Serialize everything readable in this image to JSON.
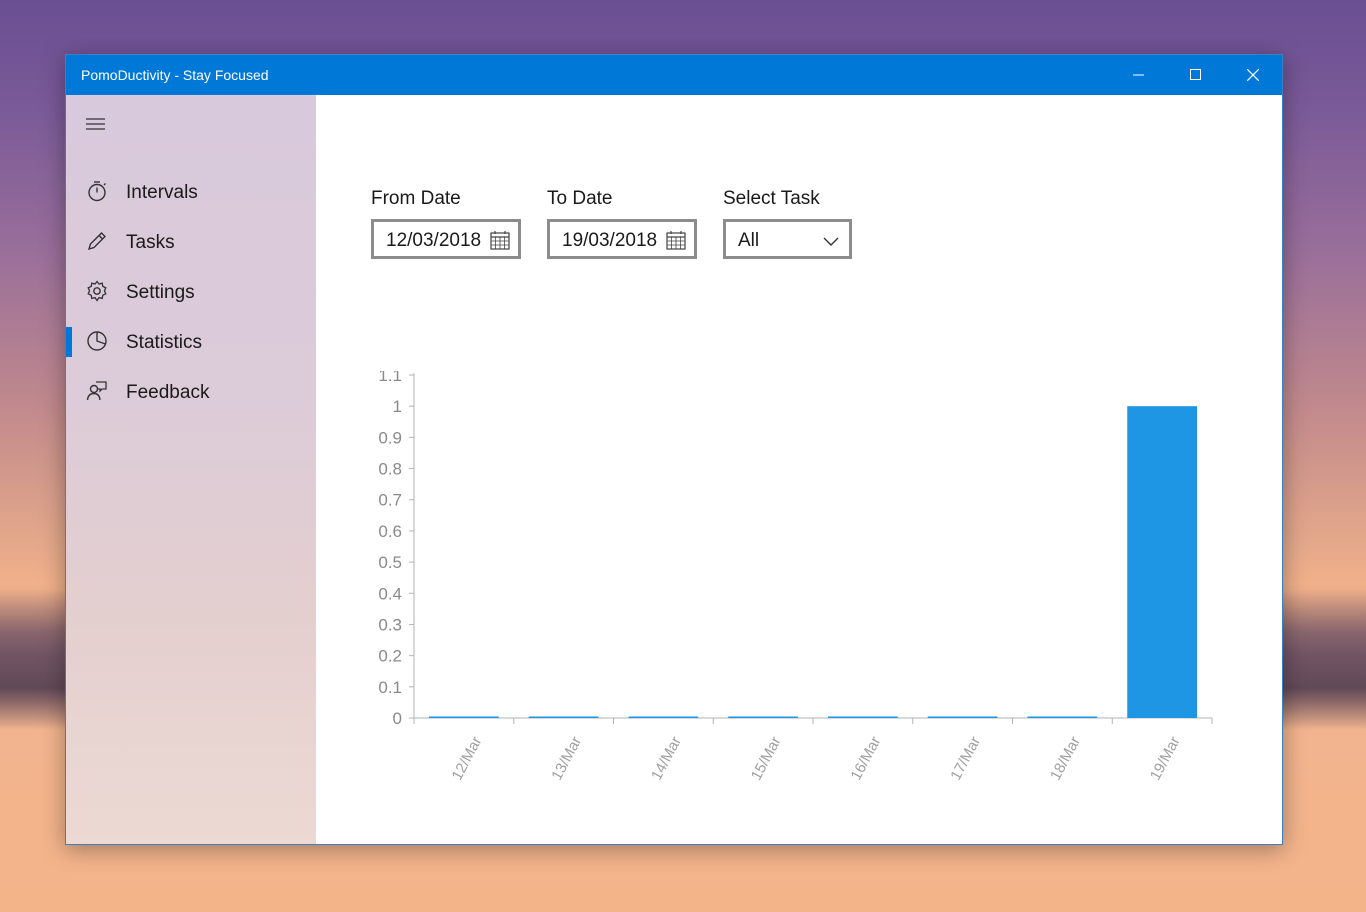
{
  "window": {
    "title": "PomoDuctivity - Stay Focused"
  },
  "controls": {
    "minimize": "minimize-icon",
    "maximize": "maximize-icon",
    "close": "close-icon"
  },
  "nav": {
    "items": [
      {
        "label": "Intervals",
        "icon": "timer-icon",
        "selected": false
      },
      {
        "label": "Tasks",
        "icon": "pencil-icon",
        "selected": false
      },
      {
        "label": "Settings",
        "icon": "gear-icon",
        "selected": false
      },
      {
        "label": "Statistics",
        "icon": "pie-chart-icon",
        "selected": true
      },
      {
        "label": "Feedback",
        "icon": "feedback-icon",
        "selected": false
      }
    ]
  },
  "filters": {
    "from_label": "From Date",
    "from_value": "12/03/2018",
    "to_label": "To Date",
    "to_value": "19/03/2018",
    "task_label": "Select Task",
    "task_value": "All"
  },
  "colors": {
    "accent": "#0078d7",
    "bar": "#1e96e3"
  },
  "chart_data": {
    "type": "bar",
    "categories": [
      "12/Mar",
      "13/Mar",
      "14/Mar",
      "15/Mar",
      "16/Mar",
      "17/Mar",
      "18/Mar",
      "19/Mar"
    ],
    "values": [
      0,
      0,
      0,
      0,
      0,
      0,
      0,
      1
    ],
    "ylim": [
      0,
      1.1
    ],
    "yticks": [
      "0",
      "0.1",
      "0.2",
      "0.3",
      "0.4",
      "0.5",
      "0.6",
      "0.7",
      "0.8",
      "0.9",
      "1",
      "1.1"
    ],
    "grid": false
  }
}
